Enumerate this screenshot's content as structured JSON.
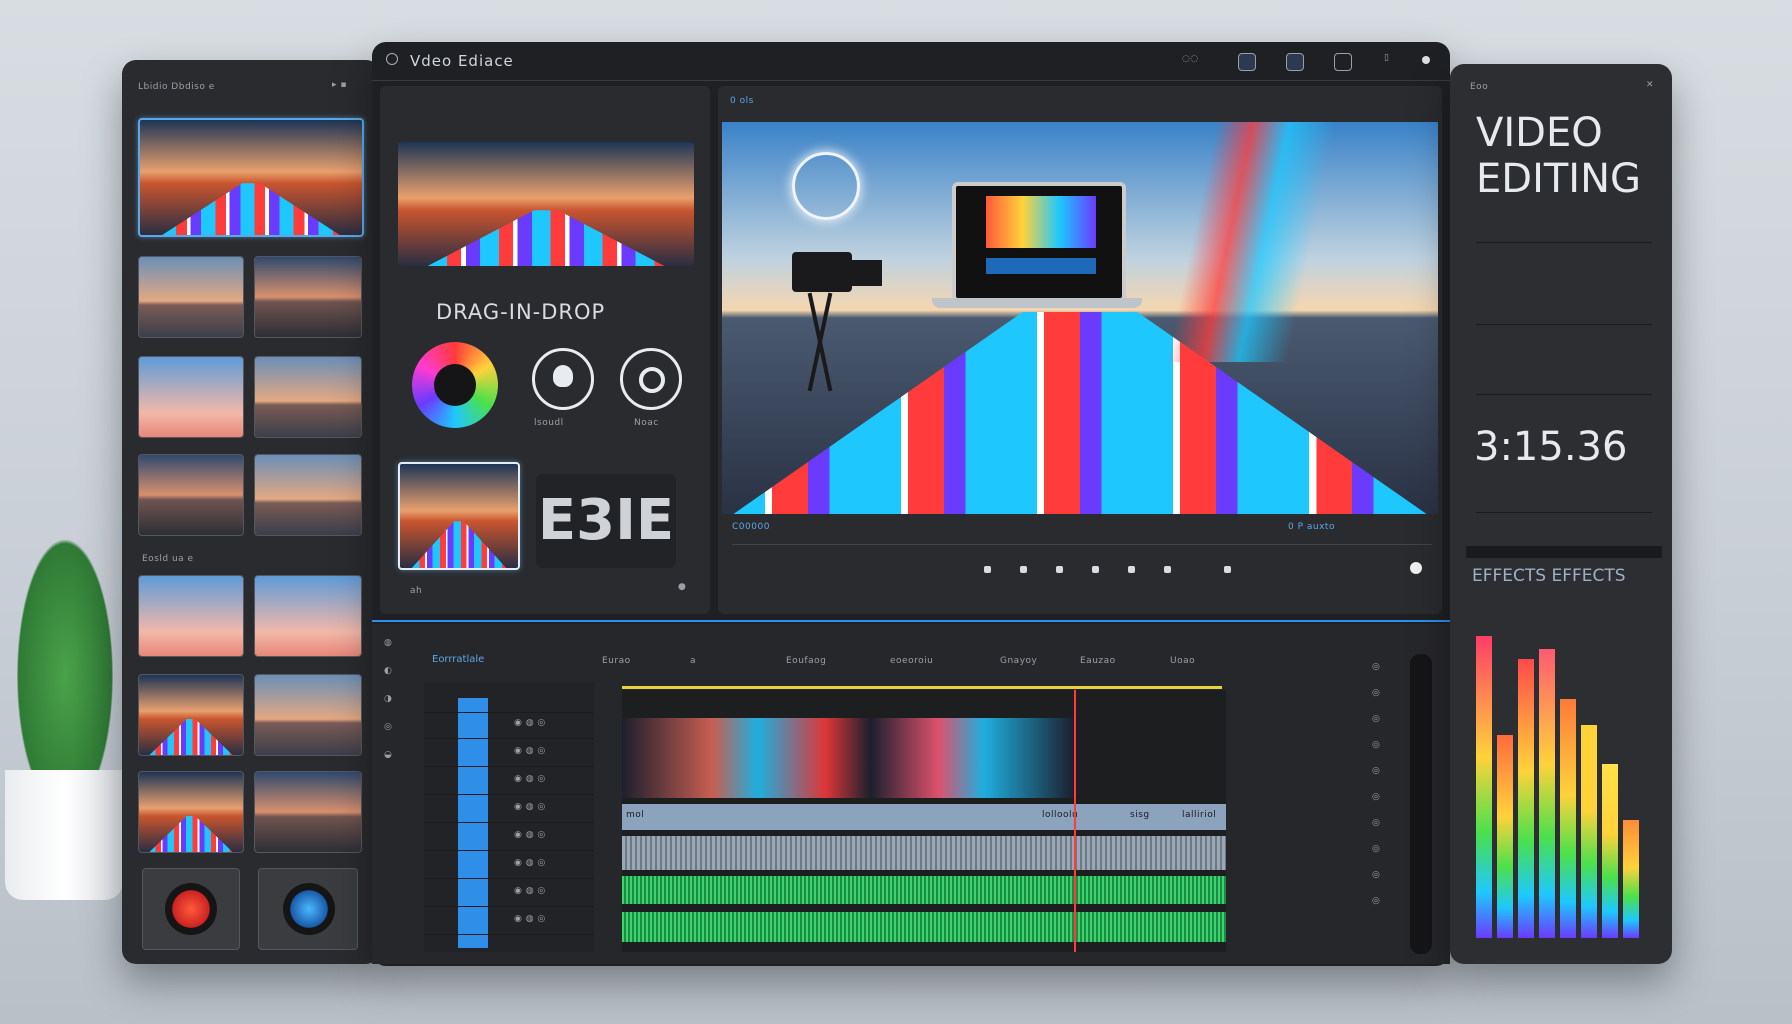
{
  "app": {
    "title": "Vdeo Ediace",
    "window_controls": [
      "minimize-icon",
      "settings-icon",
      "export-icon",
      "share-icon",
      "close-icon"
    ]
  },
  "left_panel": {
    "header": "Lbidio Dbdiso e",
    "section2_label": "Eosld ua e"
  },
  "tools_panel": {
    "drag_label": "DRAG-IN-DROP",
    "tool1_label": "lsoudl",
    "tool2_label": "Noac",
    "big_text": "E3IE",
    "footer_text": "ah"
  },
  "preview": {
    "header_label": "0 ols",
    "timecode_left": "C00000",
    "timecode_right": "0 P auxto"
  },
  "timeline": {
    "header_label": "Eorrratlale",
    "ruler_labels": [
      "Eurao",
      "a",
      "Eoufaog",
      "eoeoroiu",
      "Gnayoy",
      "Eauzao",
      "Uoao"
    ],
    "clip_labels": [
      "mol",
      "lolloolu",
      "sisg",
      "lalliriol"
    ]
  },
  "right_panel": {
    "title_line1": "VIDEO",
    "title_line2": "EDITING",
    "header_mini": "Eoo",
    "timer": "3:15.36",
    "effects_label": "EFFECTS EFFECTS"
  },
  "effects_levels": {
    "values": [
      0.92,
      0.62,
      0.85,
      0.88,
      0.73,
      0.65,
      0.53,
      0.36
    ],
    "colors": [
      "#ff3d68",
      "#ff6a3d",
      "#ff4a4a",
      "#ff5a72",
      "#ff7a3a",
      "#ffd23a",
      "#ffe14a",
      "#ff8a3a"
    ]
  },
  "colors": {
    "accent": "#2e8ee8",
    "playhead": "#ff3b3b",
    "waveform": "#38d66b",
    "panel": "#2a2b2e"
  }
}
